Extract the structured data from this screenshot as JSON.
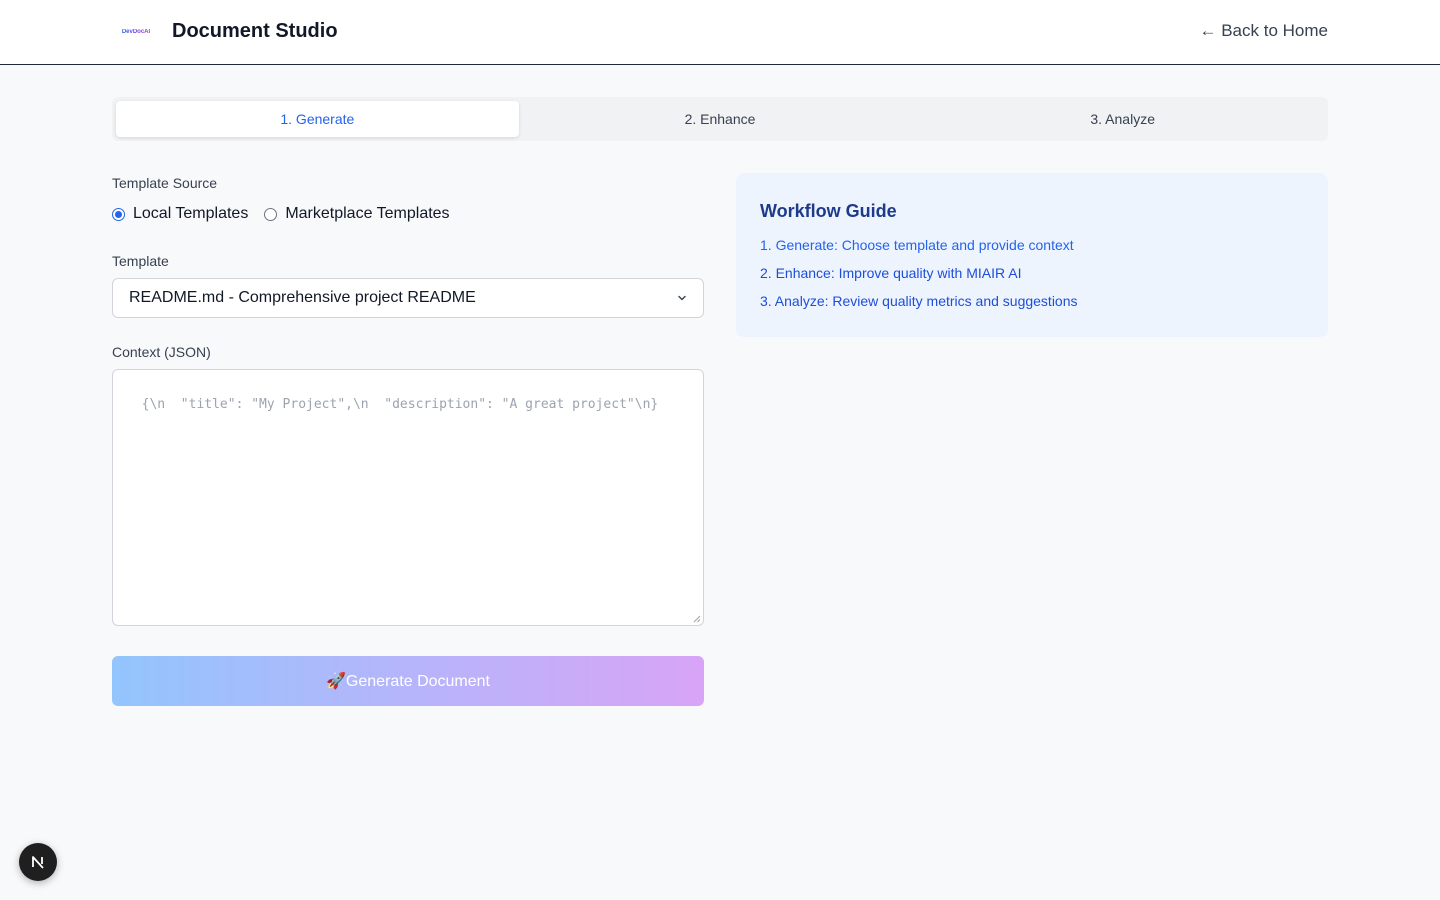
{
  "header": {
    "logo_text": "DevDocAI",
    "title": "Document Studio",
    "back_link": "← Back to Home"
  },
  "tabs": [
    {
      "label": "1. Generate",
      "active": true
    },
    {
      "label": "2. Enhance",
      "active": false
    },
    {
      "label": "3. Analyze",
      "active": false
    }
  ],
  "form": {
    "template_source_label": "Template Source",
    "source_options": [
      {
        "label": "Local Templates",
        "checked": true
      },
      {
        "label": "Marketplace Templates",
        "checked": false
      }
    ],
    "template_label": "Template",
    "template_selected": "README.md - Comprehensive project README",
    "context_label": "Context (JSON)",
    "context_placeholder": "{\\n  \"title\": \"My Project\",\\n  \"description\": \"A great project\"\\n}",
    "generate_button": "🚀Generate Document"
  },
  "guide": {
    "title": "Workflow Guide",
    "items": [
      "1. Generate: Choose template and provide context",
      "2. Enhance: Improve quality with MIAIR AI",
      "3. Analyze: Review quality metrics and suggestions"
    ]
  },
  "badge": {
    "letter": "N"
  },
  "colors": {
    "accent": "#2563eb",
    "guide_bg": "#eef4fe",
    "button_gradient_start": "#93c5fd",
    "button_gradient_end": "#d8a4f7"
  }
}
